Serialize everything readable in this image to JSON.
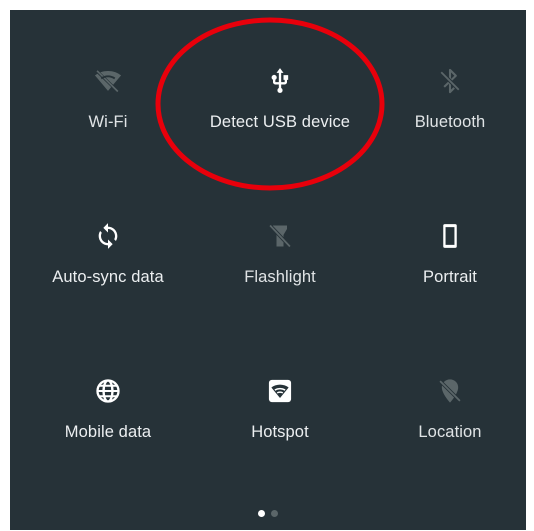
{
  "quick_settings": {
    "tiles": [
      {
        "label": "Wi-Fi",
        "icon": "wifi-off-icon",
        "state": "off"
      },
      {
        "label": "Detect USB device",
        "icon": "usb-icon",
        "state": "on"
      },
      {
        "label": "Bluetooth",
        "icon": "bluetooth-off-icon",
        "state": "off"
      },
      {
        "label": "Auto-sync data",
        "icon": "sync-icon",
        "state": "on"
      },
      {
        "label": "Flashlight",
        "icon": "flashlight-off-icon",
        "state": "off"
      },
      {
        "label": "Portrait",
        "icon": "screen-rotation-portrait-icon",
        "state": "on"
      },
      {
        "label": "Mobile data",
        "icon": "globe-icon",
        "state": "on"
      },
      {
        "label": "Hotspot",
        "icon": "hotspot-icon",
        "state": "on"
      },
      {
        "label": "Location",
        "icon": "location-off-icon",
        "state": "off"
      }
    ],
    "page_indicator": {
      "pages": 2,
      "current": 1
    }
  },
  "annotation": {
    "highlight_color": "#e8000b",
    "highlighted_tile": "Detect USB device"
  },
  "colors": {
    "panel_background": "#263238",
    "icon_on": "#ffffff",
    "icon_off": "#5b6669",
    "label_on": "#eceff1",
    "dot_active": "#ffffff",
    "dot_inactive": "#5b6669"
  }
}
